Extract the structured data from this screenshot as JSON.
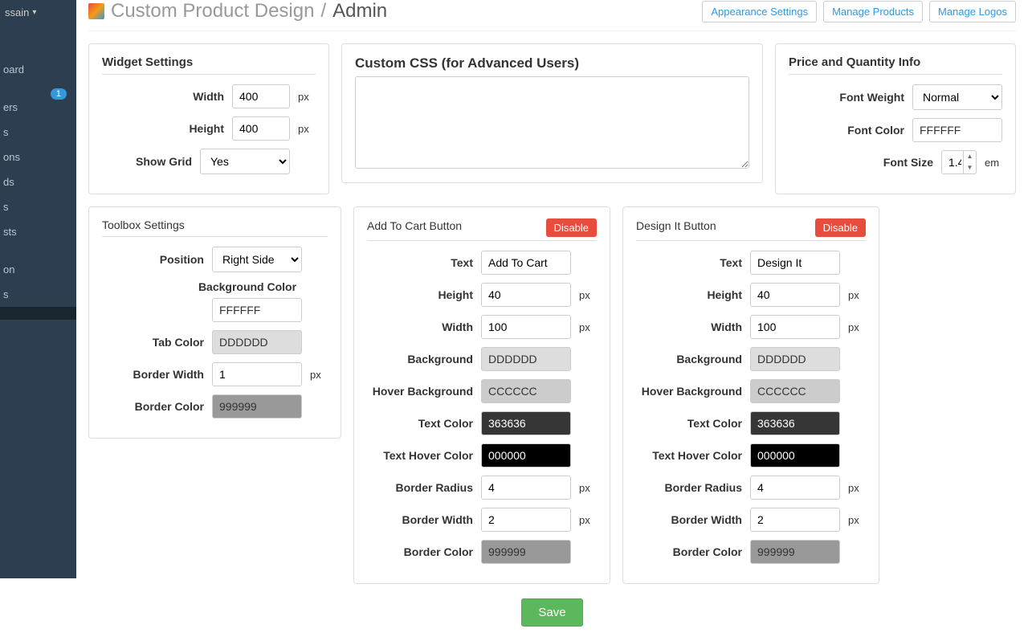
{
  "user": {
    "name": "ssain",
    "caret": "▾"
  },
  "sidebar": {
    "items": [
      {
        "label": "oard"
      },
      {
        "label": "",
        "badge": "1"
      },
      {
        "label": "ers"
      },
      {
        "label": "s"
      },
      {
        "label": "ons"
      },
      {
        "label": "ds"
      },
      {
        "label": "s"
      },
      {
        "label": "sts"
      },
      {
        "label": ""
      },
      {
        "label": "on"
      },
      {
        "label": "s"
      },
      {
        "label": ""
      }
    ]
  },
  "header": {
    "title_main": "Custom Product Design",
    "title_sep": "/",
    "title_sub": "Admin",
    "btns": {
      "appearance": "Appearance Settings",
      "products": "Manage Products",
      "logos": "Manage Logos"
    }
  },
  "widget": {
    "title": "Widget Settings",
    "width_label": "Width",
    "width": "400",
    "height_label": "Height",
    "height": "400",
    "showgrid_label": "Show Grid",
    "showgrid": "Yes",
    "px": "px"
  },
  "css": {
    "title": "Custom CSS (for Advanced Users)",
    "value": ""
  },
  "price": {
    "title": "Price and Quantity Info",
    "fw_label": "Font Weight",
    "fw": "Normal",
    "fc_label": "Font Color",
    "fc": "FFFFFF",
    "fs_label": "Font Size",
    "fs": "1.4",
    "em": "em"
  },
  "toolbox": {
    "title": "Toolbox Settings",
    "pos_label": "Position",
    "pos": "Right Side",
    "bg_label": "Background Color",
    "bg": "FFFFFF",
    "tab_label": "Tab Color",
    "tab": "DDDDDD",
    "bw_label": "Border Width",
    "bw": "1",
    "px": "px",
    "bc_label": "Border Color",
    "bc": "999999"
  },
  "addcart": {
    "title": "Add To Cart Button",
    "disable": "Disable",
    "text_label": "Text",
    "text": "Add To Cart",
    "h_label": "Height",
    "h": "40",
    "w_label": "Width",
    "w": "100",
    "bg_label": "Background",
    "bg": "DDDDDD",
    "hbg_label": "Hover Background",
    "hbg": "CCCCCC",
    "tc_label": "Text Color",
    "tc": "363636",
    "thc_label": "Text Hover Color",
    "thc": "000000",
    "br_label": "Border Radius",
    "br": "4",
    "bw_label": "Border Width",
    "bw": "2",
    "bc_label": "Border Color",
    "bc": "999999",
    "px": "px"
  },
  "design": {
    "title": "Design It Button",
    "disable": "Disable",
    "text_label": "Text",
    "text": "Design It",
    "h_label": "Height",
    "h": "40",
    "w_label": "Width",
    "w": "100",
    "bg_label": "Background",
    "bg": "DDDDDD",
    "hbg_label": "Hover Background",
    "hbg": "CCCCCC",
    "tc_label": "Text Color",
    "tc": "363636",
    "thc_label": "Text Hover Color",
    "thc": "000000",
    "br_label": "Border Radius",
    "br": "4",
    "bw_label": "Border Width",
    "bw": "2",
    "bc_label": "Border Color",
    "bc": "999999",
    "px": "px"
  },
  "save": "Save",
  "colors": {
    "FFFFFF": "#FFFFFF",
    "DDDDDD": "#DDDDDD",
    "999999": "#999999",
    "CCCCCC": "#CCCCCC",
    "363636": "#363636",
    "000000": "#000000"
  }
}
